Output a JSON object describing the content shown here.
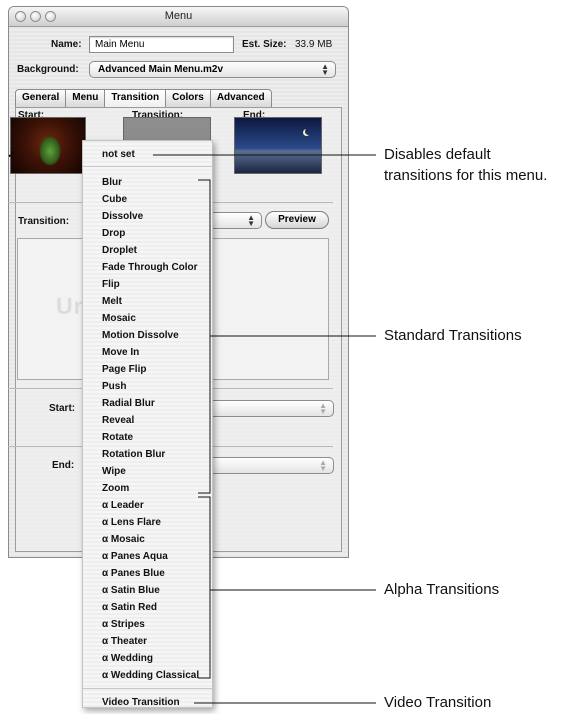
{
  "window": {
    "title": "Menu"
  },
  "header": {
    "name_label": "Name:",
    "name_value": "Main Menu",
    "est_size_label": "Est. Size:",
    "est_size_value": "33.9 MB",
    "background_label": "Background:",
    "background_value": "Advanced Main Menu.m2v"
  },
  "tabs": [
    {
      "label": "General"
    },
    {
      "label": "Menu"
    },
    {
      "label": "Transition"
    },
    {
      "label": "Colors"
    },
    {
      "label": "Advanced"
    }
  ],
  "panel": {
    "start_label": "Start:",
    "transition_label": "Transition:",
    "end_label": "End:",
    "transition_field_label": "Transition:",
    "preview_button": "Preview",
    "unavailable_text": "Unavailable",
    "start_row_label": "Start:",
    "end_row_label": "End:"
  },
  "menu": {
    "selected": "not set",
    "items": [
      "not set",
      "Blur",
      "Cube",
      "Dissolve",
      "Drop",
      "Droplet",
      "Fade Through Color",
      "Flip",
      "Melt",
      "Mosaic",
      "Motion Dissolve",
      "Move In",
      "Page Flip",
      "Push",
      "Radial Blur",
      "Reveal",
      "Rotate",
      "Rotation Blur",
      "Wipe",
      "Zoom",
      "α Leader",
      "α Lens Flare",
      "α Mosaic",
      "α Panes Aqua",
      "α Panes Blue",
      "α Satin Blue",
      "α Satin Red",
      "α Stripes",
      "α Theater",
      "α Wedding",
      "α Wedding Classical",
      "Video Transition"
    ]
  },
  "callouts": {
    "not_set_line1": "Disables default",
    "not_set_line2": "transitions for this menu.",
    "standard": "Standard Transitions",
    "alpha": "Alpha Transitions",
    "video": "Video Transition"
  },
  "icons": {
    "checkmark": "checkmark-icon",
    "popup_arrows": "updown-arrows-icon"
  }
}
